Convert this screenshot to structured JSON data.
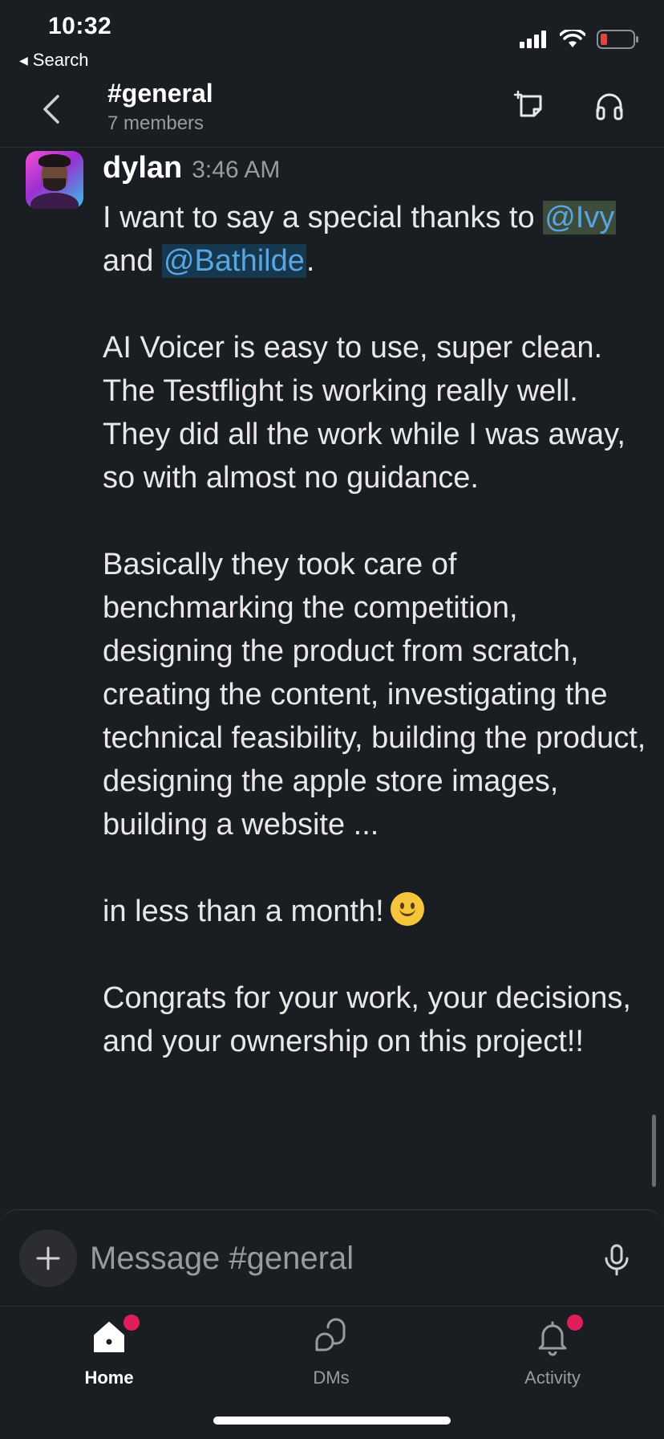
{
  "status_bar": {
    "time": "10:32",
    "back_to_app": "Search",
    "icons": [
      "signal-icon",
      "wifi-icon",
      "battery-icon"
    ],
    "battery_color": "#e0453f"
  },
  "header": {
    "channel": "#general",
    "members": "7 members",
    "icons": [
      "back-chevron-icon",
      "canvas-icon",
      "headphones-icon"
    ]
  },
  "message": {
    "author": "dylan",
    "time": "3:46 AM",
    "p1_before": "I want to say a special thanks to",
    "mention1": "@Ivy",
    "p1_and": " and ",
    "mention2": "@Bathilde",
    "p1_end": ".",
    "p2": "AI Voicer is easy to use, super clean. The Testflight is working really well. They did all the work while I was away, so with almost no guidance.",
    "p3": "Basically they took care of benchmarking the competition, designing the product from scratch, creating the content, investigating the technical feasibility, building the product, designing the apple store images, building a website ...",
    "p4": "in less than a month!",
    "p4_emoji": "slightly-smiling-face-emoji",
    "p5": "Congrats for your work, your decisions, and your ownership on this project!!"
  },
  "composer": {
    "placeholder": "Message #general",
    "icons": [
      "plus-icon",
      "microphone-icon"
    ]
  },
  "tabbar": {
    "tabs": [
      {
        "label": "Home",
        "icon": "home-icon",
        "active": true,
        "badge": true
      },
      {
        "label": "DMs",
        "icon": "dms-icon",
        "active": false,
        "badge": false
      },
      {
        "label": "Activity",
        "icon": "bell-icon",
        "active": false,
        "badge": true
      }
    ],
    "badge_color": "#e01e5a"
  }
}
